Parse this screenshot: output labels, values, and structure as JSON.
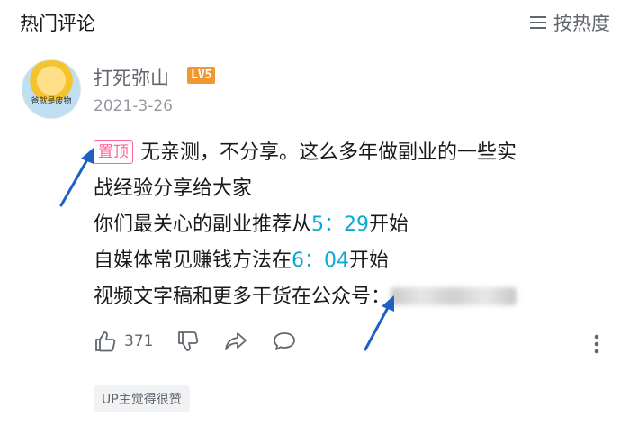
{
  "header": {
    "title": "热门评论",
    "sort_label": "按热度"
  },
  "comment": {
    "avatar_text": "爸就是废物",
    "username": "打死弥山",
    "level": "LV5",
    "date": "2021-3-26",
    "pin_label": "置顶",
    "line1": "无亲测，不分享。这么多年做副业的一些实",
    "line2": "战经验分享给大家",
    "line3_pre": "你们最关心的副业推荐从",
    "line3_ts": "5：29",
    "line3_post": "开始",
    "line4_pre": "自媒体常见赚钱方法在",
    "line4_ts": "6：04",
    "line4_post": "开始",
    "line5": "视频文字稿和更多干货在公众号：",
    "likes": "371",
    "badge": "UP主觉得很赞"
  },
  "colors": {
    "accent_pink": "#ff6699",
    "timestamp_blue": "#0aa8d6",
    "level_orange": "#f29830",
    "arrow_blue": "#1f5fc4"
  },
  "icons": [
    "sort-icon",
    "like-icon",
    "dislike-icon",
    "share-icon",
    "reply-icon",
    "more-icon"
  ]
}
